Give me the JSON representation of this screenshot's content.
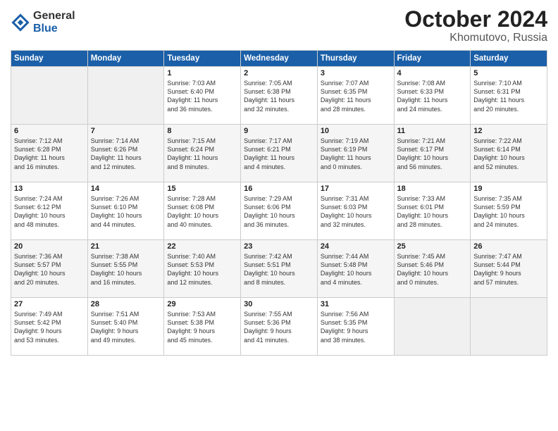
{
  "header": {
    "logo_general": "General",
    "logo_blue": "Blue",
    "month_title": "October 2024",
    "location": "Khomutovo, Russia"
  },
  "weekdays": [
    "Sunday",
    "Monday",
    "Tuesday",
    "Wednesday",
    "Thursday",
    "Friday",
    "Saturday"
  ],
  "weeks": [
    [
      {
        "day": "",
        "info": ""
      },
      {
        "day": "",
        "info": ""
      },
      {
        "day": "1",
        "info": "Sunrise: 7:03 AM\nSunset: 6:40 PM\nDaylight: 11 hours\nand 36 minutes."
      },
      {
        "day": "2",
        "info": "Sunrise: 7:05 AM\nSunset: 6:38 PM\nDaylight: 11 hours\nand 32 minutes."
      },
      {
        "day": "3",
        "info": "Sunrise: 7:07 AM\nSunset: 6:35 PM\nDaylight: 11 hours\nand 28 minutes."
      },
      {
        "day": "4",
        "info": "Sunrise: 7:08 AM\nSunset: 6:33 PM\nDaylight: 11 hours\nand 24 minutes."
      },
      {
        "day": "5",
        "info": "Sunrise: 7:10 AM\nSunset: 6:31 PM\nDaylight: 11 hours\nand 20 minutes."
      }
    ],
    [
      {
        "day": "6",
        "info": "Sunrise: 7:12 AM\nSunset: 6:28 PM\nDaylight: 11 hours\nand 16 minutes."
      },
      {
        "day": "7",
        "info": "Sunrise: 7:14 AM\nSunset: 6:26 PM\nDaylight: 11 hours\nand 12 minutes."
      },
      {
        "day": "8",
        "info": "Sunrise: 7:15 AM\nSunset: 6:24 PM\nDaylight: 11 hours\nand 8 minutes."
      },
      {
        "day": "9",
        "info": "Sunrise: 7:17 AM\nSunset: 6:21 PM\nDaylight: 11 hours\nand 4 minutes."
      },
      {
        "day": "10",
        "info": "Sunrise: 7:19 AM\nSunset: 6:19 PM\nDaylight: 11 hours\nand 0 minutes."
      },
      {
        "day": "11",
        "info": "Sunrise: 7:21 AM\nSunset: 6:17 PM\nDaylight: 10 hours\nand 56 minutes."
      },
      {
        "day": "12",
        "info": "Sunrise: 7:22 AM\nSunset: 6:14 PM\nDaylight: 10 hours\nand 52 minutes."
      }
    ],
    [
      {
        "day": "13",
        "info": "Sunrise: 7:24 AM\nSunset: 6:12 PM\nDaylight: 10 hours\nand 48 minutes."
      },
      {
        "day": "14",
        "info": "Sunrise: 7:26 AM\nSunset: 6:10 PM\nDaylight: 10 hours\nand 44 minutes."
      },
      {
        "day": "15",
        "info": "Sunrise: 7:28 AM\nSunset: 6:08 PM\nDaylight: 10 hours\nand 40 minutes."
      },
      {
        "day": "16",
        "info": "Sunrise: 7:29 AM\nSunset: 6:06 PM\nDaylight: 10 hours\nand 36 minutes."
      },
      {
        "day": "17",
        "info": "Sunrise: 7:31 AM\nSunset: 6:03 PM\nDaylight: 10 hours\nand 32 minutes."
      },
      {
        "day": "18",
        "info": "Sunrise: 7:33 AM\nSunset: 6:01 PM\nDaylight: 10 hours\nand 28 minutes."
      },
      {
        "day": "19",
        "info": "Sunrise: 7:35 AM\nSunset: 5:59 PM\nDaylight: 10 hours\nand 24 minutes."
      }
    ],
    [
      {
        "day": "20",
        "info": "Sunrise: 7:36 AM\nSunset: 5:57 PM\nDaylight: 10 hours\nand 20 minutes."
      },
      {
        "day": "21",
        "info": "Sunrise: 7:38 AM\nSunset: 5:55 PM\nDaylight: 10 hours\nand 16 minutes."
      },
      {
        "day": "22",
        "info": "Sunrise: 7:40 AM\nSunset: 5:53 PM\nDaylight: 10 hours\nand 12 minutes."
      },
      {
        "day": "23",
        "info": "Sunrise: 7:42 AM\nSunset: 5:51 PM\nDaylight: 10 hours\nand 8 minutes."
      },
      {
        "day": "24",
        "info": "Sunrise: 7:44 AM\nSunset: 5:48 PM\nDaylight: 10 hours\nand 4 minutes."
      },
      {
        "day": "25",
        "info": "Sunrise: 7:45 AM\nSunset: 5:46 PM\nDaylight: 10 hours\nand 0 minutes."
      },
      {
        "day": "26",
        "info": "Sunrise: 7:47 AM\nSunset: 5:44 PM\nDaylight: 9 hours\nand 57 minutes."
      }
    ],
    [
      {
        "day": "27",
        "info": "Sunrise: 7:49 AM\nSunset: 5:42 PM\nDaylight: 9 hours\nand 53 minutes."
      },
      {
        "day": "28",
        "info": "Sunrise: 7:51 AM\nSunset: 5:40 PM\nDaylight: 9 hours\nand 49 minutes."
      },
      {
        "day": "29",
        "info": "Sunrise: 7:53 AM\nSunset: 5:38 PM\nDaylight: 9 hours\nand 45 minutes."
      },
      {
        "day": "30",
        "info": "Sunrise: 7:55 AM\nSunset: 5:36 PM\nDaylight: 9 hours\nand 41 minutes."
      },
      {
        "day": "31",
        "info": "Sunrise: 7:56 AM\nSunset: 5:35 PM\nDaylight: 9 hours\nand 38 minutes."
      },
      {
        "day": "",
        "info": ""
      },
      {
        "day": "",
        "info": ""
      }
    ]
  ]
}
